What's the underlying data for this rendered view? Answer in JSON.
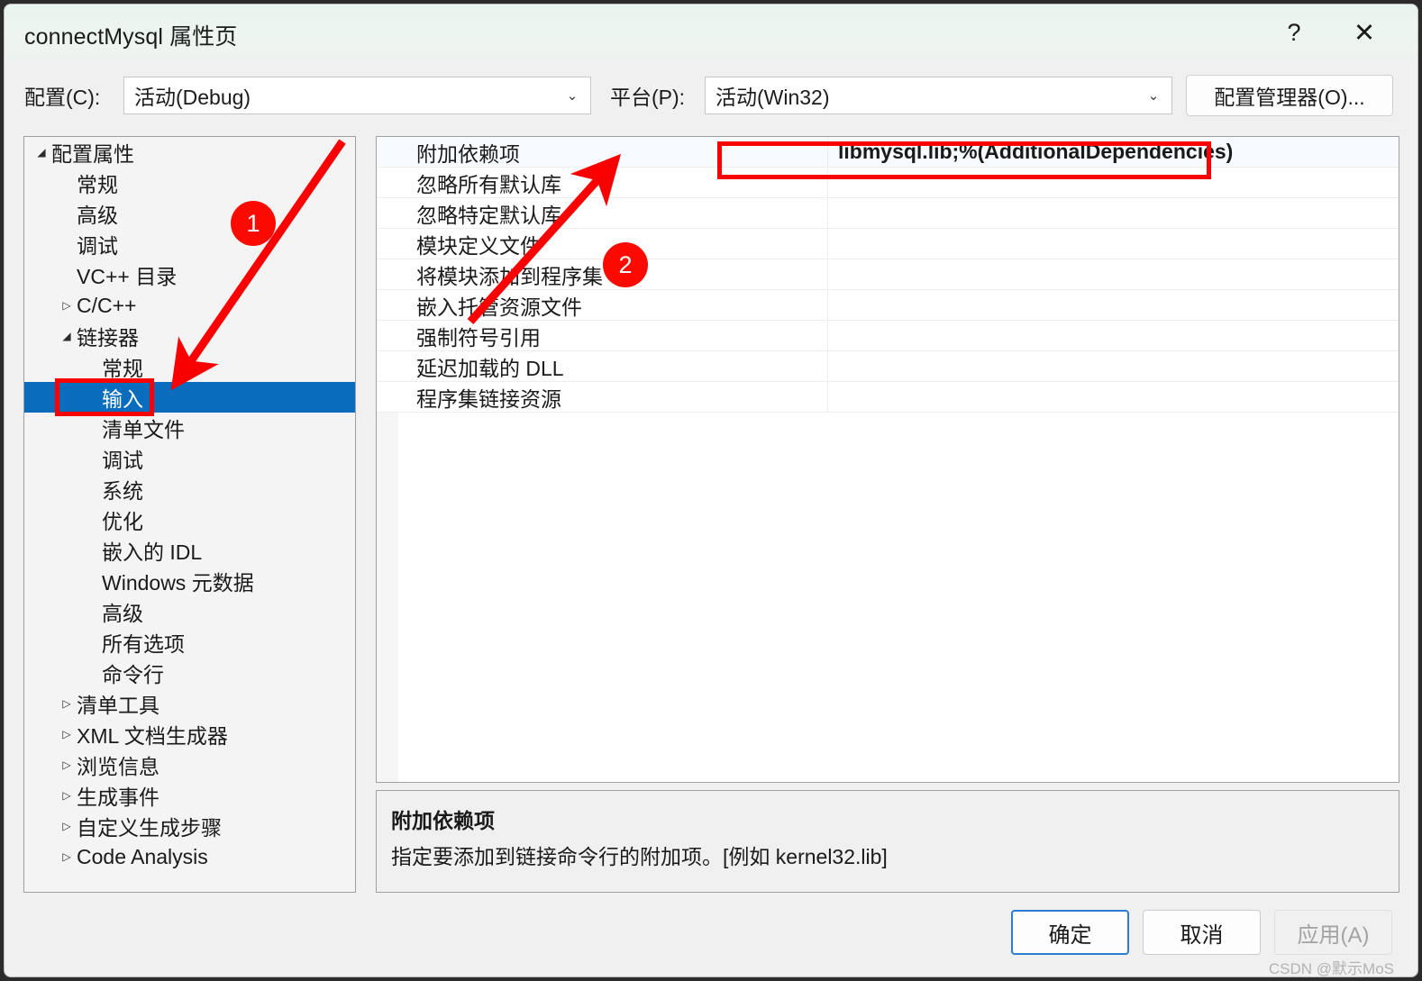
{
  "window": {
    "title": "connectMysql 属性页",
    "help_icon": "?",
    "close_icon": "✕"
  },
  "config_bar": {
    "configuration_label": "配置(C):",
    "configuration_value": "活动(Debug)",
    "platform_label": "平台(P):",
    "platform_value": "活动(Win32)",
    "config_manager_button": "配置管理器(O)...",
    "caret_icon": "⌄"
  },
  "tree": {
    "expanded_icon": "◢",
    "collapsed_icon": "▷",
    "items": [
      {
        "label": "配置属性",
        "level": 0,
        "state": "expanded",
        "selected": false
      },
      {
        "label": "常规",
        "level": 1,
        "state": "leaf",
        "selected": false
      },
      {
        "label": "高级",
        "level": 1,
        "state": "leaf",
        "selected": false
      },
      {
        "label": "调试",
        "level": 1,
        "state": "leaf",
        "selected": false
      },
      {
        "label": "VC++ 目录",
        "level": 1,
        "state": "leaf",
        "selected": false
      },
      {
        "label": "C/C++",
        "level": 0,
        "state": "collapsed",
        "selected": false,
        "indent": 1
      },
      {
        "label": "链接器",
        "level": 0,
        "state": "expanded",
        "selected": false,
        "indent": 1
      },
      {
        "label": "常规",
        "level": 1,
        "state": "leaf",
        "selected": false,
        "indent": 2
      },
      {
        "label": "输入",
        "level": 1,
        "state": "leaf",
        "selected": true,
        "indent": 2
      },
      {
        "label": "清单文件",
        "level": 1,
        "state": "leaf",
        "selected": false,
        "indent": 2
      },
      {
        "label": "调试",
        "level": 1,
        "state": "leaf",
        "selected": false,
        "indent": 2
      },
      {
        "label": "系统",
        "level": 1,
        "state": "leaf",
        "selected": false,
        "indent": 2
      },
      {
        "label": "优化",
        "level": 1,
        "state": "leaf",
        "selected": false,
        "indent": 2
      },
      {
        "label": "嵌入的 IDL",
        "level": 1,
        "state": "leaf",
        "selected": false,
        "indent": 2
      },
      {
        "label": "Windows 元数据",
        "level": 1,
        "state": "leaf",
        "selected": false,
        "indent": 2
      },
      {
        "label": "高级",
        "level": 1,
        "state": "leaf",
        "selected": false,
        "indent": 2
      },
      {
        "label": "所有选项",
        "level": 1,
        "state": "leaf",
        "selected": false,
        "indent": 2
      },
      {
        "label": "命令行",
        "level": 1,
        "state": "leaf",
        "selected": false,
        "indent": 2
      },
      {
        "label": "清单工具",
        "level": 0,
        "state": "collapsed",
        "selected": false,
        "indent": 1
      },
      {
        "label": "XML 文档生成器",
        "level": 0,
        "state": "collapsed",
        "selected": false,
        "indent": 1
      },
      {
        "label": "浏览信息",
        "level": 0,
        "state": "collapsed",
        "selected": false,
        "indent": 1
      },
      {
        "label": "生成事件",
        "level": 0,
        "state": "collapsed",
        "selected": false,
        "indent": 1
      },
      {
        "label": "自定义生成步骤",
        "level": 0,
        "state": "collapsed",
        "selected": false,
        "indent": 1
      },
      {
        "label": "Code Analysis",
        "level": 0,
        "state": "collapsed",
        "selected": false,
        "indent": 1
      }
    ]
  },
  "properties": {
    "rows": [
      {
        "name": "附加依赖项",
        "value": "libmysql.lib;%(AdditionalDependencies)"
      },
      {
        "name": "忽略所有默认库",
        "value": ""
      },
      {
        "name": "忽略特定默认库",
        "value": ""
      },
      {
        "name": "模块定义文件",
        "value": ""
      },
      {
        "name": "将模块添加到程序集",
        "value": ""
      },
      {
        "name": "嵌入托管资源文件",
        "value": ""
      },
      {
        "name": "强制符号引用",
        "value": ""
      },
      {
        "name": "延迟加载的 DLL",
        "value": ""
      },
      {
        "name": "程序集链接资源",
        "value": ""
      }
    ]
  },
  "description": {
    "title": "附加依赖项",
    "body": "指定要添加到链接命令行的附加项。[例如 kernel32.lib]"
  },
  "buttons": {
    "ok": "确定",
    "cancel": "取消",
    "apply": "应用(A)"
  },
  "annotations": {
    "badge_1": "1",
    "badge_2": "2",
    "highlight_color": "#fa0000",
    "selection_color": "#0a6cbd"
  },
  "watermark": "CSDN @默示MoS"
}
